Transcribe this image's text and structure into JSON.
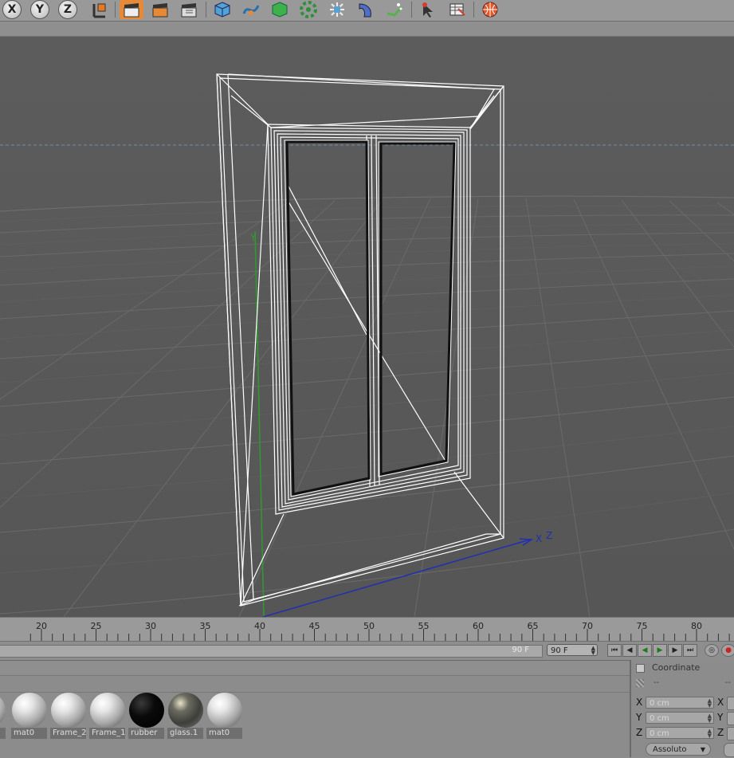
{
  "toolbar": {
    "axis_buttons": [
      "X",
      "Y",
      "Z"
    ],
    "icons": [
      "coordinate-system-icon",
      "render-view-icon",
      "render-picture-viewer-icon",
      "render-settings-icon",
      "cube-primitive-icon",
      "spline-pen-icon",
      "nurbs-icon",
      "modeling-array-icon",
      "deformer-icon",
      "environment-icon",
      "camera-icon",
      "scene-object-icon",
      "selection-tool-icon",
      "tag-list-icon",
      "python-icon"
    ]
  },
  "timeline": {
    "ticks": [
      "20",
      "25",
      "30",
      "35",
      "40",
      "45",
      "50",
      "55",
      "60",
      "65",
      "70",
      "75",
      "80"
    ],
    "end_frame_label": "90 F",
    "frame_field": "90 F",
    "transport_icons": [
      "go-to-start-icon",
      "previous-key-icon",
      "play-backwards-icon",
      "play-forwards-icon",
      "next-key-icon",
      "go-to-end-icon"
    ]
  },
  "materials": [
    {
      "name": "mat0",
      "style": "white"
    },
    {
      "name": "Frame_2",
      "style": "white"
    },
    {
      "name": "Frame_1",
      "style": "white"
    },
    {
      "name": "rubber",
      "style": "black"
    },
    {
      "name": "glass.1",
      "style": "glass"
    },
    {
      "name": "mat0",
      "style": "white"
    }
  ],
  "coordinates": {
    "title": "Coordinate",
    "placeholder": "--",
    "rows": [
      {
        "axis": "X",
        "value": "0 cm",
        "axis2": "X"
      },
      {
        "axis": "Y",
        "value": "0 cm",
        "axis2": "Y"
      },
      {
        "axis": "Z",
        "value": "0 cm",
        "axis2": "Z"
      }
    ],
    "mode": "Assoluto"
  },
  "viewport": {
    "y_axis_label": "Y",
    "z_axis_label": "Z",
    "x_axis_label": "X"
  }
}
